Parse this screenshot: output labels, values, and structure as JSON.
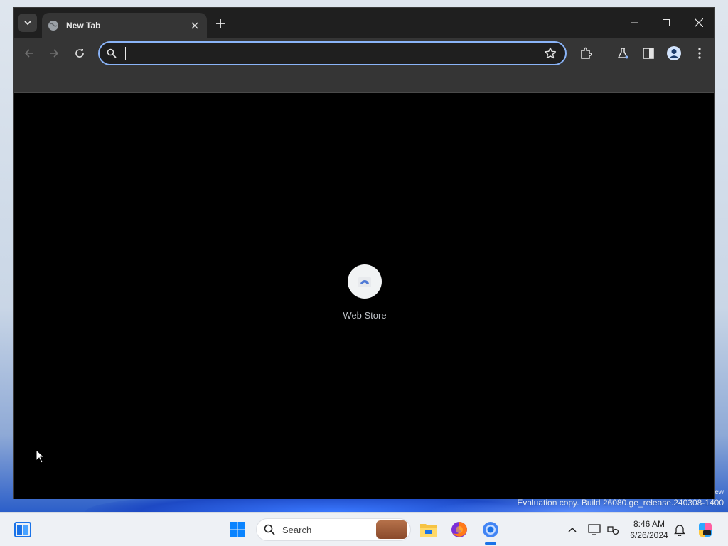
{
  "browser": {
    "tab": {
      "title": "New Tab"
    },
    "omnibox": {
      "value": "",
      "placeholder": ""
    },
    "shortcuts": [
      {
        "label": "Web Store"
      }
    ]
  },
  "desktop": {
    "watermark_line1": "ew",
    "watermark_line2": "Evaluation copy. Build 26080.ge_release.240308-1400"
  },
  "taskbar": {
    "search_label": "Search",
    "time": "8:46 AM",
    "date": "6/26/2024"
  },
  "colors": {
    "accent": "#8ab4f8",
    "tabstrip": "#1f1f1f",
    "toolbar": "#353535",
    "content": "#000000"
  }
}
